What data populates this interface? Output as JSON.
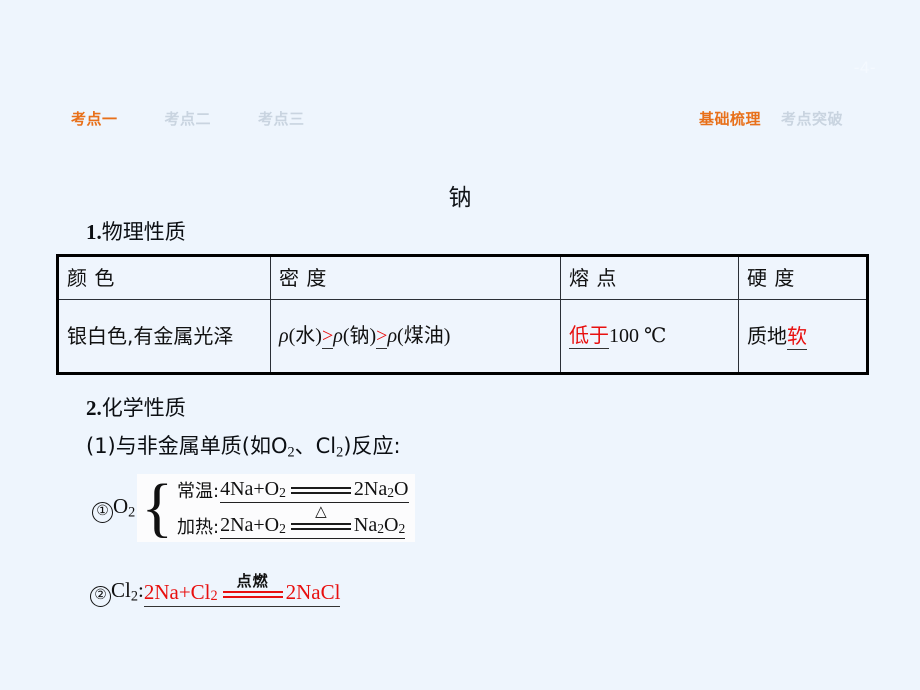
{
  "page": {
    "number": "-4-"
  },
  "topnav": {
    "left_items": [
      {
        "label": "考点一",
        "state": "active"
      },
      {
        "label": "考点二",
        "state": "inactive"
      },
      {
        "label": "考点三",
        "state": "inactive"
      }
    ],
    "right_items": [
      {
        "label": "基础梳理",
        "state": "active"
      },
      {
        "label": "考点突破",
        "state": "inactive"
      }
    ]
  },
  "slide": {
    "title": "钠",
    "section1": {
      "num": "1.",
      "label": "物理性质"
    },
    "section2": {
      "num": "2.",
      "label": "化学性质"
    },
    "subsection": {
      "prefix": "(1)与非金属单质(如O",
      "sub1": "2",
      "mid": "、Cl",
      "sub2": "2",
      "suffix": ")反应:"
    }
  },
  "table": {
    "headers": [
      "颜  色",
      "密  度",
      "熔  点",
      "硬  度"
    ],
    "row": {
      "color": "银白色,有金属光泽",
      "density": {
        "rho": "ρ",
        "water": "(水)",
        "op1": ">",
        "sodium": "(钠)",
        "op2": ">",
        "kerosene": "(煤油)"
      },
      "melting": {
        "answer": "低于",
        "rest": "100  ℃"
      },
      "hardness": {
        "prefix": "质地",
        "answer": "软"
      }
    }
  },
  "equations": {
    "o2_group": {
      "marker": "①",
      "species": "O",
      "species_sub": "2",
      "rows": [
        {
          "condition": "常温:",
          "left": "4Na+O",
          "left_sub": "2",
          "over": "",
          "right": "2Na",
          "right_sub": "2",
          "right_tail": "O"
        },
        {
          "condition": "加热:",
          "left": "2Na+O",
          "left_sub": "2",
          "over": "△",
          "right": "Na",
          "right_sub": "2",
          "right_tail": "O",
          "right_tail_sub": "2"
        }
      ]
    },
    "cl2_row": {
      "marker": "②",
      "species": "Cl",
      "species_sub": "2",
      "colon": ":",
      "left": "2Na+Cl",
      "left_sub": "2",
      "over": "点燃",
      "right": "2NaCl"
    }
  },
  "colors": {
    "background": "#eef5fd",
    "accent": "#e8701a",
    "inactive": "#c9d4e0",
    "answer_red": "#e8100f",
    "text": "#111111"
  }
}
